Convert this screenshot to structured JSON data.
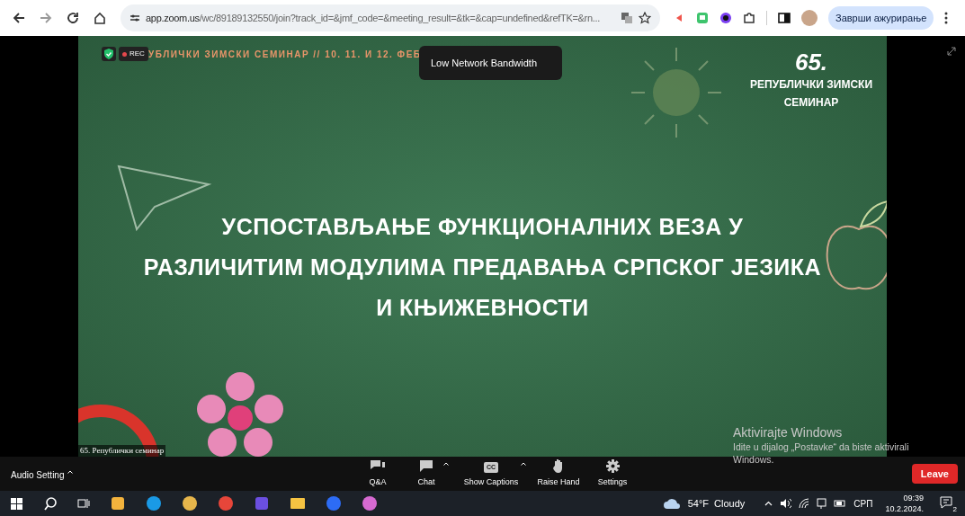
{
  "browser": {
    "url_host": "app.zoom.us",
    "url_path": "/wc/89189132550/join?track_id=&jmf_code=&meeting_result=&tk=&cap=undefined&refTK=&rn...",
    "update_button": "Заврши ажурирање"
  },
  "meeting": {
    "rec_badge": "REC",
    "tooltip": "Low Network Bandwidth",
    "slide": {
      "header_strip": "УБЛИЧКИ ЗИМСКИ СЕМИНАР // 10. 11. И 12. ФЕБ",
      "badge_number": "65.",
      "badge_lines": [
        "РЕПУБЛИЧКИ ЗИМСКИ",
        "СЕМИНАР"
      ],
      "title_lines": [
        "УСПОСТАВЉАЊЕ ФУНКЦИОНАЛНИХ ВЕЗА У",
        "РАЗЛИЧИТИМ МОДУЛИМА ПРЕДАВАЊА СРПСКОГ ЈЕЗИКА",
        "И КЊИЖЕВНОСТИ"
      ]
    },
    "participant_name": "65. Републички семинар"
  },
  "activation": {
    "title": "Aktivirajte Windows",
    "message": "Idite u dijalog „Postavke“ da biste aktivirali Windows."
  },
  "toolbar": {
    "audio": "Audio Setting",
    "buttons": [
      {
        "kind": "qa",
        "label": "Q&A",
        "caret": false
      },
      {
        "kind": "chat",
        "label": "Chat",
        "caret": true
      },
      {
        "kind": "captions",
        "label": "Show Captions",
        "icon_text": "CC",
        "caret": true
      },
      {
        "kind": "hand",
        "label": "Raise Hand",
        "caret": false
      },
      {
        "kind": "settings",
        "label": "Settings",
        "caret": false
      }
    ],
    "leave": "Leave"
  },
  "taskbar": {
    "weather": "54°F  Cloudy",
    "language": "СРП",
    "time": "09:39",
    "date": "10.2.2024.",
    "notifications": "2"
  }
}
